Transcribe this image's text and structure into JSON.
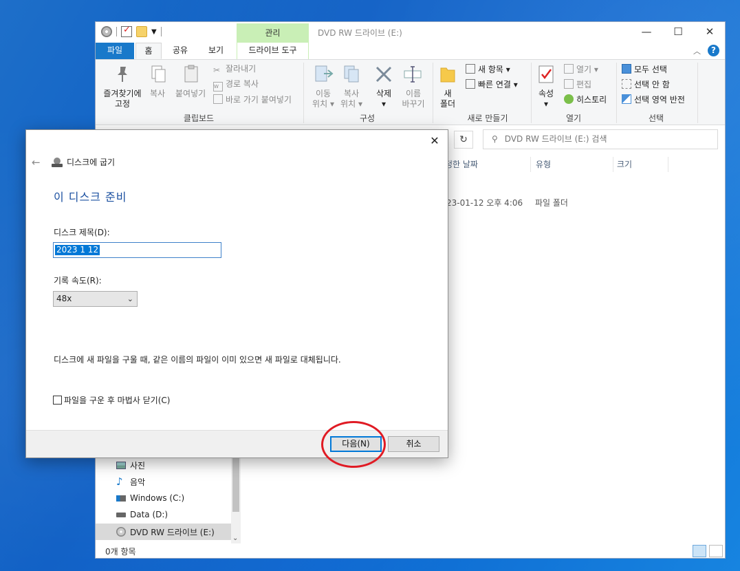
{
  "explorer": {
    "title": "DVD RW 드라이브 (E:)",
    "contextual_tab": "관리",
    "tabs": [
      "파일",
      "홈",
      "공유",
      "보기",
      "드라이브 도구"
    ],
    "ribbon": {
      "pin_label_1": "즐겨찾기에",
      "pin_label_2": "고정",
      "copy": "복사",
      "paste": "붙여넣기",
      "cut": "잘라내기",
      "copy_path": "경로 복사",
      "paste_shortcut": "바로 가기 붙여넣기",
      "group_clipboard": "클립보드",
      "move_1": "이동",
      "move_2": "위치",
      "copyto_1": "복사",
      "copyto_2": "위치",
      "delete": "삭제",
      "rename_1": "이름",
      "rename_2": "바꾸기",
      "group_organize": "구성",
      "new_folder_1": "새",
      "new_folder_2": "폴더",
      "new_item": "새 항목",
      "easy_access": "빠른 연결",
      "group_new": "새로 만들기",
      "properties": "속성",
      "open": "열기",
      "edit": "편집",
      "history": "히스토리",
      "group_open": "열기",
      "select_all": "모두 선택",
      "select_none": "선택 안 함",
      "invert_selection": "선택 영역 반전",
      "group_select": "선택"
    },
    "search_placeholder": "DVD RW 드라이브 (E:) 검색",
    "columns": {
      "modified": "정한 날짜",
      "type": "유형",
      "size": "크기"
    },
    "row": {
      "modified": "23-01-12 오후 4:06",
      "type": "파일 폴더"
    },
    "nav": {
      "pictures": "사진",
      "music": "음악",
      "c_drive": "Windows (C:)",
      "d_drive": "Data (D:)",
      "e_drive": "DVD RW 드라이브 (E:)"
    },
    "status": "0개 항목"
  },
  "dialog": {
    "wizard_title": "디스크에 굽기",
    "heading": "이 디스크 준비",
    "disc_title_label": "디스크 제목(D):",
    "disc_title_value": "2023 1 12",
    "speed_label": "기록 속도(R):",
    "speed_value": "48x",
    "info_text": "디스크에 새 파일을 구울 때, 같은 이름의 파일이 이미 있으면 새 파일로 대체됩니다.",
    "close_after_label": "파일을 구운 후 마법사 닫기(C)",
    "close_after_checked": false,
    "next_button": "다음(N)",
    "cancel_button": "취소"
  },
  "colors": {
    "accent": "#0078d7",
    "file_tab": "#1979ca",
    "manage_tab": "#c9efb6",
    "heading": "#1a4fa0",
    "annotation": "#e01b24"
  }
}
